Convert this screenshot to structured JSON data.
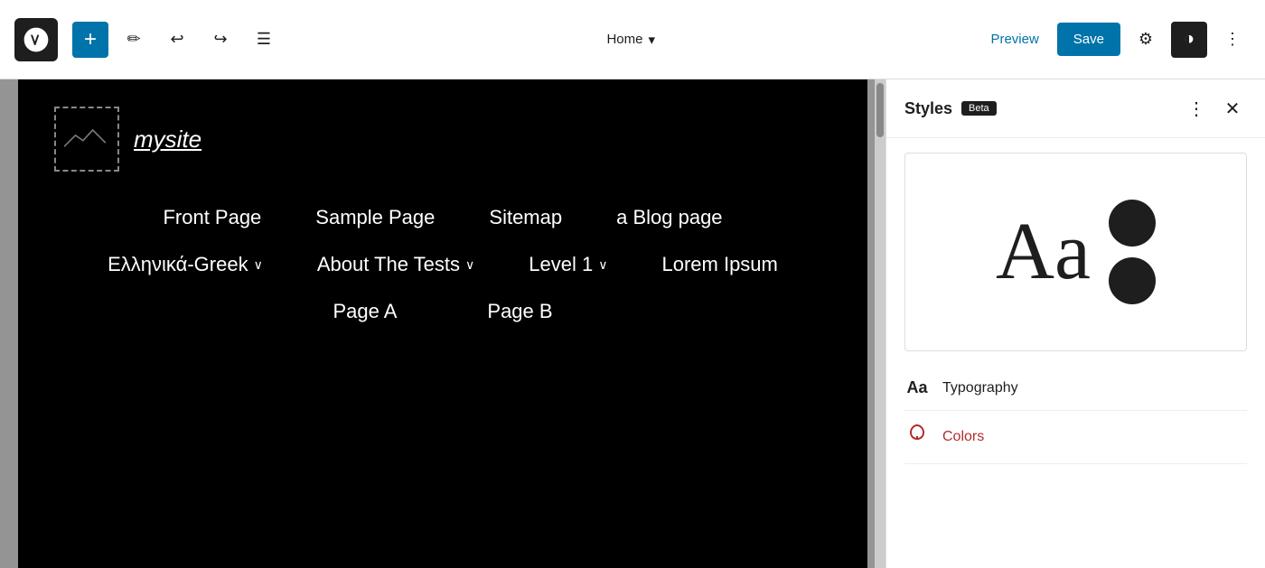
{
  "toolbar": {
    "add_label": "+",
    "page_title": "Home",
    "page_title_chevron": "▾",
    "preview_label": "Preview",
    "save_label": "Save",
    "undo_icon": "↩",
    "redo_icon": "↪",
    "list_icon": "☰",
    "pencil_icon": "✏",
    "settings_icon": "⚙",
    "more_icon": "⋮",
    "halfcircle_icon": "◑"
  },
  "site": {
    "name": "mysite",
    "nav_items": [
      {
        "label": "Front Page",
        "has_dropdown": false
      },
      {
        "label": "Sample Page",
        "has_dropdown": false
      },
      {
        "label": "Sitemap",
        "has_dropdown": false
      },
      {
        "label": "a Blog page",
        "has_dropdown": false
      }
    ],
    "nav_items_row2": [
      {
        "label": "Ελληνικά-Greek",
        "has_dropdown": true
      },
      {
        "label": "About The Tests",
        "has_dropdown": true
      },
      {
        "label": "Level 1",
        "has_dropdown": true
      },
      {
        "label": "Lorem Ipsum",
        "has_dropdown": false
      }
    ],
    "nav_items_row3": [
      {
        "label": "Page A",
        "has_dropdown": false
      },
      {
        "label": "Page B",
        "has_dropdown": false
      }
    ]
  },
  "styles_panel": {
    "title": "Styles",
    "beta_label": "Beta",
    "preview_type_label": "Aa",
    "typography_label": "Typography",
    "colors_label": "Colors"
  }
}
